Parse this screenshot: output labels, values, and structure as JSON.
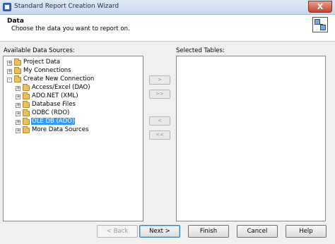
{
  "window": {
    "title": "Standard Report Creation Wizard",
    "close_glyph": "X"
  },
  "header": {
    "title": "Data",
    "subtitle": "Choose the data you want to report on.",
    "icon": "table-link-icon"
  },
  "left_panel": {
    "label": "Available Data Sources:"
  },
  "right_panel": {
    "label": "Selected Tables:"
  },
  "tree": [
    {
      "label": "Project Data",
      "expander": "+"
    },
    {
      "label": "My Connections",
      "expander": "+"
    },
    {
      "label": "Create New Connection",
      "expander": "-"
    },
    {
      "label": "Access/Excel (DAO)",
      "expander": "+"
    },
    {
      "label": "ADO.NET (XML)",
      "expander": "+"
    },
    {
      "label": "Database Files",
      "expander": "+"
    },
    {
      "label": "ODBC (RDO)",
      "expander": "+"
    },
    {
      "label": "OLE DB (ADO)",
      "expander": "+",
      "selected": true
    },
    {
      "label": "More Data Sources",
      "expander": "+"
    }
  ],
  "transfer": {
    "add": ">",
    "add_all": ">>",
    "remove": "<",
    "remove_all": "<<"
  },
  "buttons": {
    "back": "< Back",
    "next": "Next >",
    "finish": "Finish",
    "cancel": "Cancel",
    "help": "Help"
  }
}
